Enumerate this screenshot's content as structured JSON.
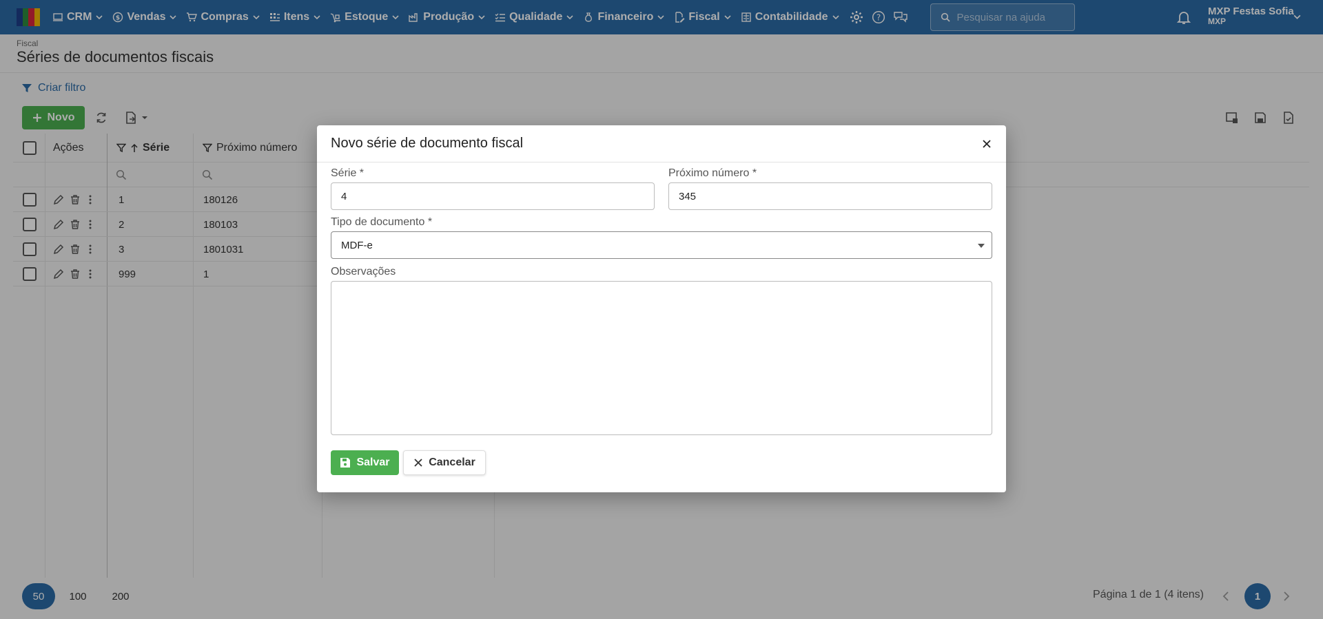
{
  "topbar": {
    "nav": [
      {
        "label": "CRM",
        "icon": "crm-icon"
      },
      {
        "label": "Vendas",
        "icon": "dollar-icon"
      },
      {
        "label": "Compras",
        "icon": "cart-icon"
      },
      {
        "label": "Itens",
        "icon": "items-icon"
      },
      {
        "label": "Estoque",
        "icon": "dolly-icon"
      },
      {
        "label": "Produção",
        "icon": "factory-icon"
      },
      {
        "label": "Qualidade",
        "icon": "checklist-icon"
      },
      {
        "label": "Financeiro",
        "icon": "money-bag-icon"
      },
      {
        "label": "Fiscal",
        "icon": "document-edit-icon"
      },
      {
        "label": "Contabilidade",
        "icon": "calculator-icon"
      }
    ],
    "search_placeholder": "Pesquisar na ajuda",
    "user_name": "MXP Festas Sofia",
    "user_org": "MXP"
  },
  "page": {
    "breadcrumb": "Fiscal",
    "title": "Séries de documentos fiscais",
    "filter_link": "Criar filtro",
    "new_button": "Novo"
  },
  "table": {
    "columns": {
      "actions": "Ações",
      "serie": "Série",
      "next_number": "Próximo número"
    },
    "rows": [
      {
        "serie": "1",
        "next": "180126"
      },
      {
        "serie": "2",
        "next": "180103"
      },
      {
        "serie": "3",
        "next": "1801031"
      },
      {
        "serie": "999",
        "next": "1"
      }
    ]
  },
  "pager": {
    "sizes": [
      "50",
      "100",
      "200"
    ],
    "info": "Página 1 de 1 (4 itens)",
    "current_page": "1"
  },
  "modal": {
    "title": "Novo série de documento fiscal",
    "serie_label": "Série *",
    "serie_value": "4",
    "next_label": "Próximo número *",
    "next_value": "345",
    "tipo_label": "Tipo de documento *",
    "tipo_value": "MDF-e",
    "obs_label": "Observações",
    "obs_value": "",
    "save_label": "Salvar",
    "cancel_label": "Cancelar"
  },
  "colors": {
    "brand": "#2b6aa6",
    "success": "#4caf50"
  }
}
